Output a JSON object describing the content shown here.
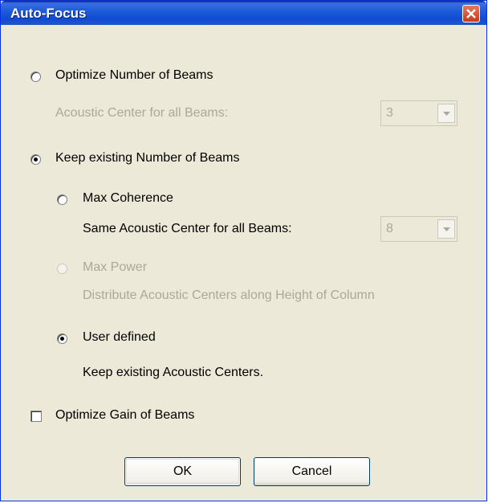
{
  "window": {
    "title": "Auto-Focus"
  },
  "optimize_beams": {
    "label": "Optimize Number of Beams",
    "selected": false
  },
  "acoustic_center_all": {
    "label": "Acoustic Center for all Beams:",
    "value": "3",
    "enabled": false
  },
  "keep_beams": {
    "label": "Keep existing Number of Beams",
    "selected": true
  },
  "max_coherence": {
    "label": "Max Coherence",
    "selected": false
  },
  "same_acoustic_center": {
    "label": "Same Acoustic Center for all Beams:",
    "value": "8",
    "enabled": false
  },
  "max_power": {
    "label": "Max Power",
    "selected": false,
    "enabled": false
  },
  "distribute_text": "Distribute Acoustic Centers along Height of Column",
  "user_defined": {
    "label": "User defined",
    "selected": true
  },
  "keep_centers_text": "Keep existing Acoustic Centers.",
  "optimize_gain": {
    "label": "Optimize Gain of Beams",
    "checked": false
  },
  "buttons": {
    "ok": "OK",
    "cancel": "Cancel"
  }
}
